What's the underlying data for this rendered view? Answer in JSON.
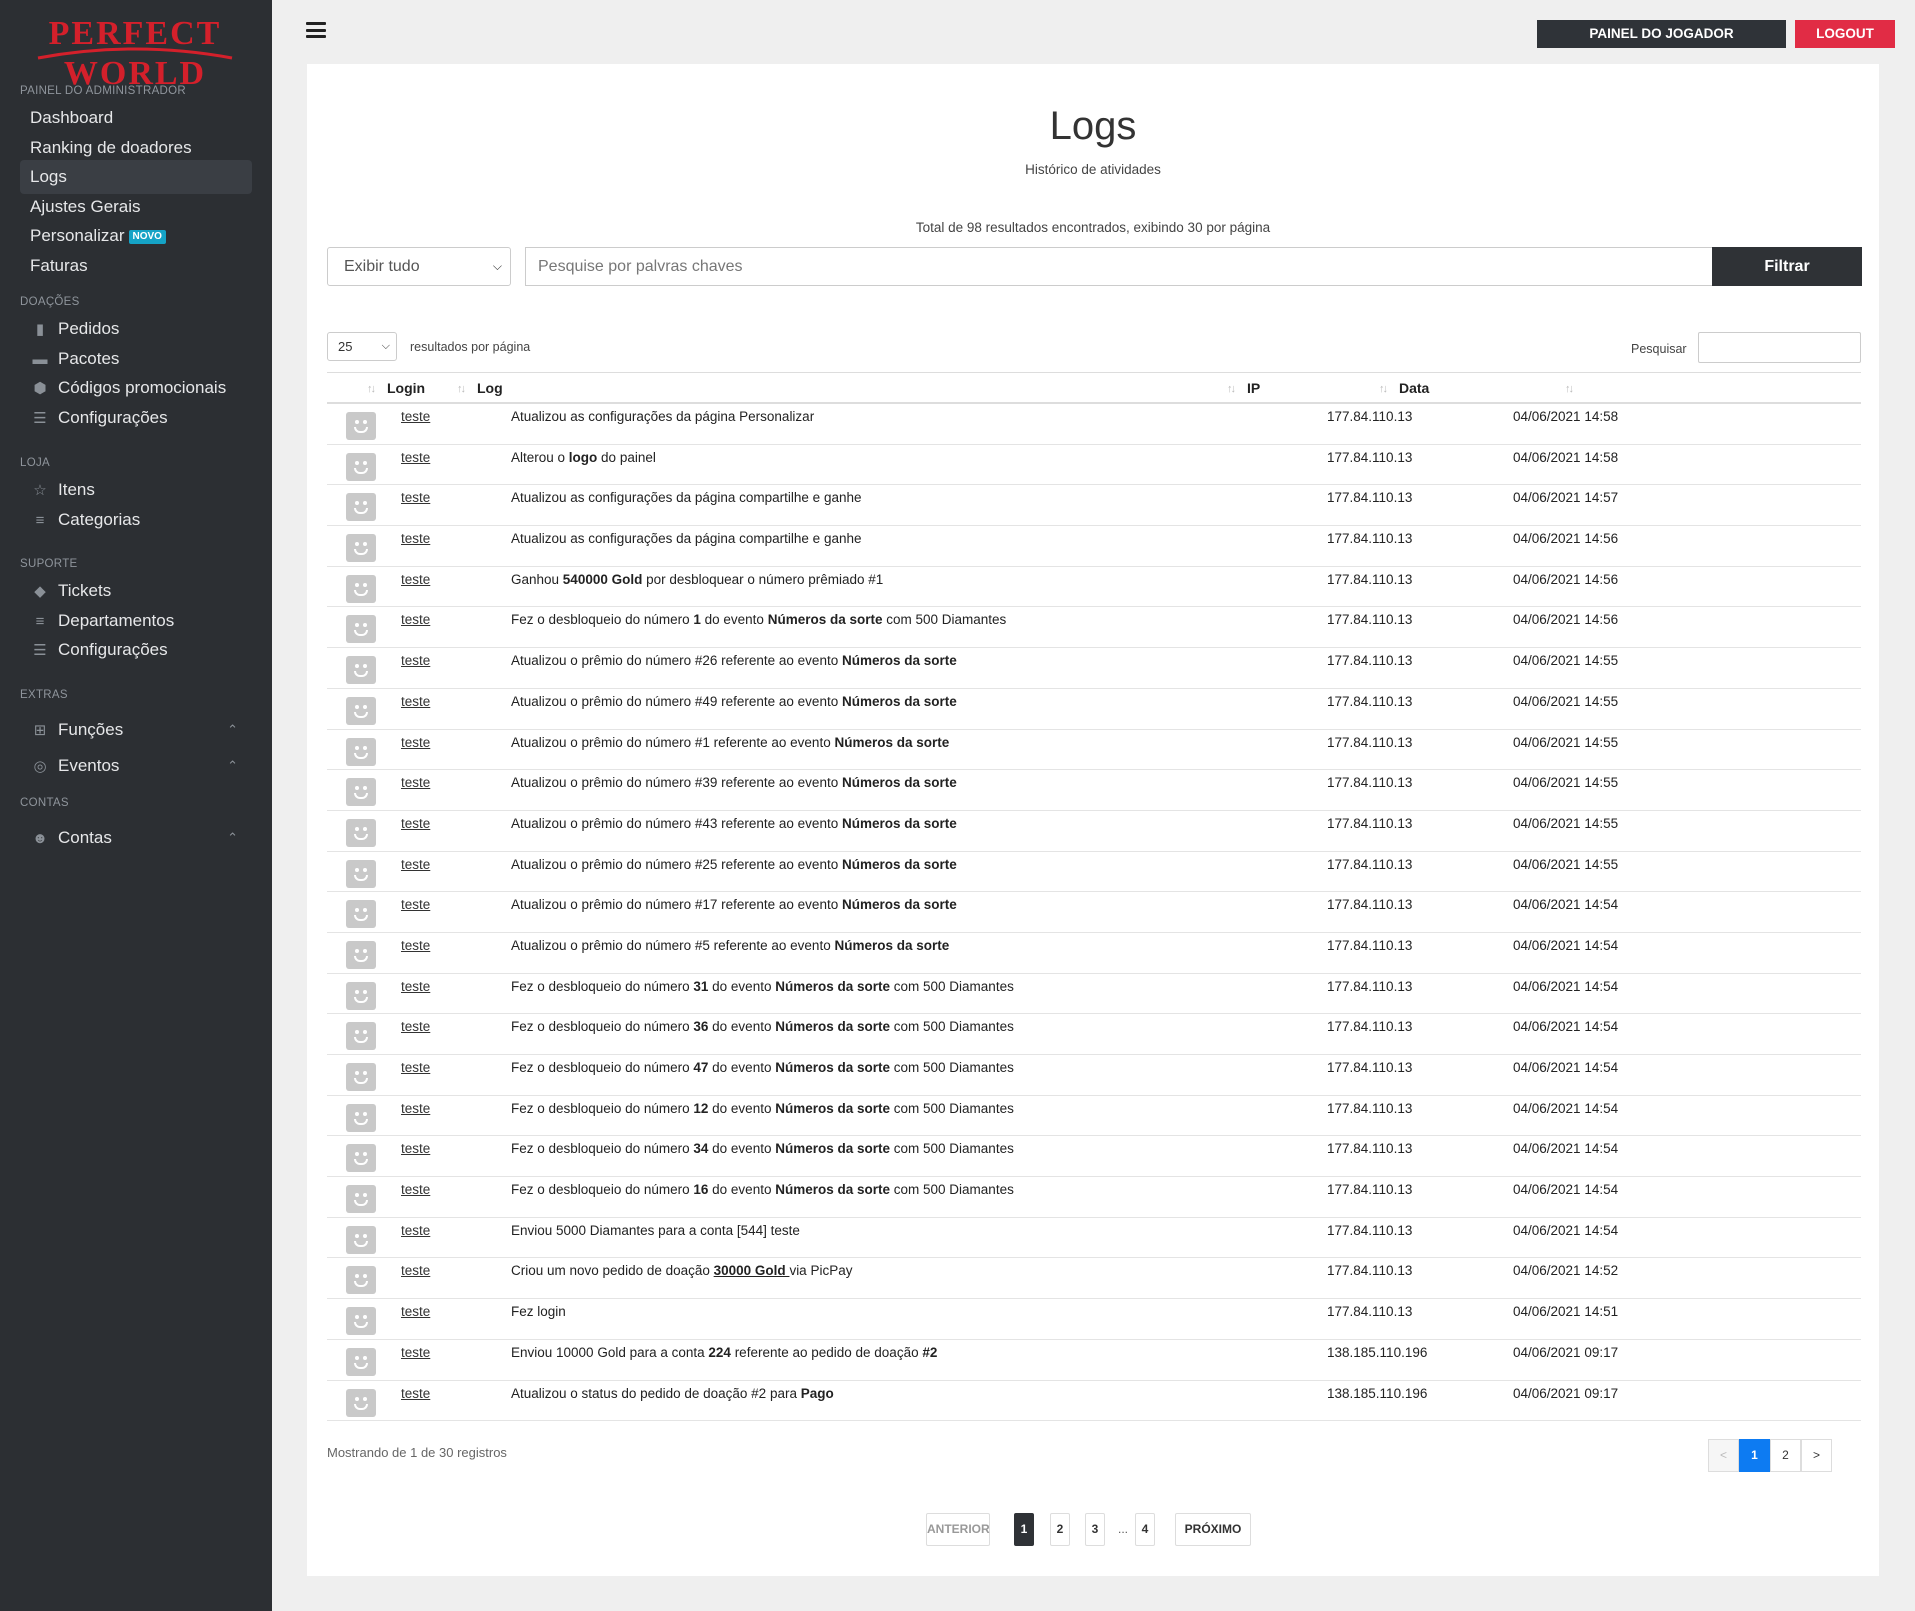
{
  "brand": {
    "line1": "PERFECT",
    "line2": "WORLD"
  },
  "sidebar": {
    "admin_label": "PAINEL DO ADMINISTRADOR",
    "admin_items": [
      {
        "label": "Dashboard"
      },
      {
        "label": "Ranking de doadores"
      },
      {
        "label": "Logs"
      },
      {
        "label": "Ajustes Gerais"
      },
      {
        "label": "Personalizar",
        "badge": "NOVO"
      },
      {
        "label": "Faturas"
      }
    ],
    "doacoes_label": "DOAÇÕES",
    "doacoes_items": [
      {
        "label": "Pedidos",
        "icon": "file-icon"
      },
      {
        "label": "Pacotes",
        "icon": "archive-icon"
      },
      {
        "label": "Códigos promocionais",
        "icon": "cube-icon"
      },
      {
        "label": "Configurações",
        "icon": "sliders-icon"
      }
    ],
    "loja_label": "LOJA",
    "loja_items": [
      {
        "label": "Itens",
        "icon": "star-icon"
      },
      {
        "label": "Categorias",
        "icon": "list-icon"
      }
    ],
    "suporte_label": "SUPORTE",
    "suporte_items": [
      {
        "label": "Tickets",
        "icon": "tag-icon"
      },
      {
        "label": "Departamentos",
        "icon": "list-icon"
      },
      {
        "label": "Configurações",
        "icon": "sliders-icon"
      }
    ],
    "extras_label": "EXTRAS",
    "extras_items": [
      {
        "label": "Funções",
        "icon": "sitemap-icon"
      },
      {
        "label": "Eventos",
        "icon": "palette-icon"
      }
    ],
    "contas_label": "CONTAS",
    "contas_items": [
      {
        "label": "Contas",
        "icon": "users-icon"
      }
    ]
  },
  "topbar": {
    "painel_label": "PAINEL DO JOGADOR",
    "logout_label": "LOGOUT"
  },
  "page": {
    "title": "Logs",
    "subtitle": "Histórico de atividades",
    "total_info": "Total de 98 resultados encontrados, exibindo 30 por página",
    "filter_select": "Exibir tudo",
    "search_placeholder": "Pesquise por palvras chaves",
    "filter_button": "Filtrar",
    "per_page_value": "25",
    "per_page_label": "resultados por página",
    "search_label": "Pesquisar"
  },
  "table": {
    "headers": {
      "login": "Login",
      "log": "Log",
      "ip": "IP",
      "date": "Data"
    },
    "rows": [
      {
        "login": "teste",
        "log": "Atualizou as configurações da página Personalizar",
        "ip": "177.84.110.13",
        "date": "04/06/2021 14:58"
      },
      {
        "login": "teste",
        "log": "Alterou o <b>logo</b> do painel",
        "ip": "177.84.110.13",
        "date": "04/06/2021 14:58"
      },
      {
        "login": "teste",
        "log": "Atualizou as configurações da página compartilhe e ganhe",
        "ip": "177.84.110.13",
        "date": "04/06/2021 14:57"
      },
      {
        "login": "teste",
        "log": "Atualizou as configurações da página compartilhe e ganhe",
        "ip": "177.84.110.13",
        "date": "04/06/2021 14:56"
      },
      {
        "login": "teste",
        "log": "Ganhou <b>540000 Gold</b> por desbloquear o número prêmiado #1",
        "ip": "177.84.110.13",
        "date": "04/06/2021 14:56"
      },
      {
        "login": "teste",
        "log": "Fez o desbloqueio do número <b>1</b> do evento <b>Números da sorte</b> com 500 Diamantes",
        "ip": "177.84.110.13",
        "date": "04/06/2021 14:56"
      },
      {
        "login": "teste",
        "log": "Atualizou o prêmio do número #26 referente ao evento <b>Números da sorte</b>",
        "ip": "177.84.110.13",
        "date": "04/06/2021 14:55"
      },
      {
        "login": "teste",
        "log": "Atualizou o prêmio do número #49 referente ao evento <b>Números da sorte</b>",
        "ip": "177.84.110.13",
        "date": "04/06/2021 14:55"
      },
      {
        "login": "teste",
        "log": "Atualizou o prêmio do número #1 referente ao evento <b>Números da sorte</b>",
        "ip": "177.84.110.13",
        "date": "04/06/2021 14:55"
      },
      {
        "login": "teste",
        "log": "Atualizou o prêmio do número #39 referente ao evento <b>Números da sorte</b>",
        "ip": "177.84.110.13",
        "date": "04/06/2021 14:55"
      },
      {
        "login": "teste",
        "log": "Atualizou o prêmio do número #43 referente ao evento <b>Números da sorte</b>",
        "ip": "177.84.110.13",
        "date": "04/06/2021 14:55"
      },
      {
        "login": "teste",
        "log": "Atualizou o prêmio do número #25 referente ao evento <b>Números da sorte</b>",
        "ip": "177.84.110.13",
        "date": "04/06/2021 14:55"
      },
      {
        "login": "teste",
        "log": "Atualizou o prêmio do número #17 referente ao evento <b>Números da sorte</b>",
        "ip": "177.84.110.13",
        "date": "04/06/2021 14:54"
      },
      {
        "login": "teste",
        "log": "Atualizou o prêmio do número #5 referente ao evento <b>Números da sorte</b>",
        "ip": "177.84.110.13",
        "date": "04/06/2021 14:54"
      },
      {
        "login": "teste",
        "log": "Fez o desbloqueio do número <b>31</b> do evento <b>Números da sorte</b> com 500 Diamantes",
        "ip": "177.84.110.13",
        "date": "04/06/2021 14:54"
      },
      {
        "login": "teste",
        "log": "Fez o desbloqueio do número <b>36</b> do evento <b>Números da sorte</b> com 500 Diamantes",
        "ip": "177.84.110.13",
        "date": "04/06/2021 14:54"
      },
      {
        "login": "teste",
        "log": "Fez o desbloqueio do número <b>47</b> do evento <b>Números da sorte</b> com 500 Diamantes",
        "ip": "177.84.110.13",
        "date": "04/06/2021 14:54"
      },
      {
        "login": "teste",
        "log": "Fez o desbloqueio do número <b>12</b> do evento <b>Números da sorte</b> com 500 Diamantes",
        "ip": "177.84.110.13",
        "date": "04/06/2021 14:54"
      },
      {
        "login": "teste",
        "log": "Fez o desbloqueio do número <b>34</b> do evento <b>Números da sorte</b> com 500 Diamantes",
        "ip": "177.84.110.13",
        "date": "04/06/2021 14:54"
      },
      {
        "login": "teste",
        "log": "Fez o desbloqueio do número <b>16</b> do evento <b>Números da sorte</b> com 500 Diamantes",
        "ip": "177.84.110.13",
        "date": "04/06/2021 14:54"
      },
      {
        "login": "teste",
        "log": "Enviou 5000 Diamantes para a conta [544] teste",
        "ip": "177.84.110.13",
        "date": "04/06/2021 14:54"
      },
      {
        "login": "teste",
        "log": "Criou um novo pedido de doação <a>30000 Gold </a> via PicPay",
        "ip": "177.84.110.13",
        "date": "04/06/2021 14:52"
      },
      {
        "login": "teste",
        "log": "Fez login",
        "ip": "177.84.110.13",
        "date": "04/06/2021 14:51"
      },
      {
        "login": "teste",
        "log": "Enviou 10000 Gold para a conta <b>224</b> referente ao pedido de doação <b>#2</b>",
        "ip": "138.185.110.196",
        "date": "04/06/2021 09:17"
      },
      {
        "login": "teste",
        "log": "Atualizou o status do pedido de doação #2 para <b>Pago</b>",
        "ip": "138.185.110.196",
        "date": "04/06/2021 09:17"
      }
    ]
  },
  "footer": {
    "showing": "Mostrando de 1 de 30 registros",
    "small_pager": [
      "<",
      "1",
      "2",
      ">"
    ],
    "big_pager": {
      "prev": "ANTERIOR",
      "pages": [
        "1",
        "2",
        "3",
        "4"
      ],
      "dots": "...",
      "next": "PRÓXIMO"
    }
  },
  "colors": {
    "sidebar": "#2c2f33",
    "logout": "#e12c45",
    "brand_red": "#d4202b",
    "active_page": "#0d7bf2"
  }
}
